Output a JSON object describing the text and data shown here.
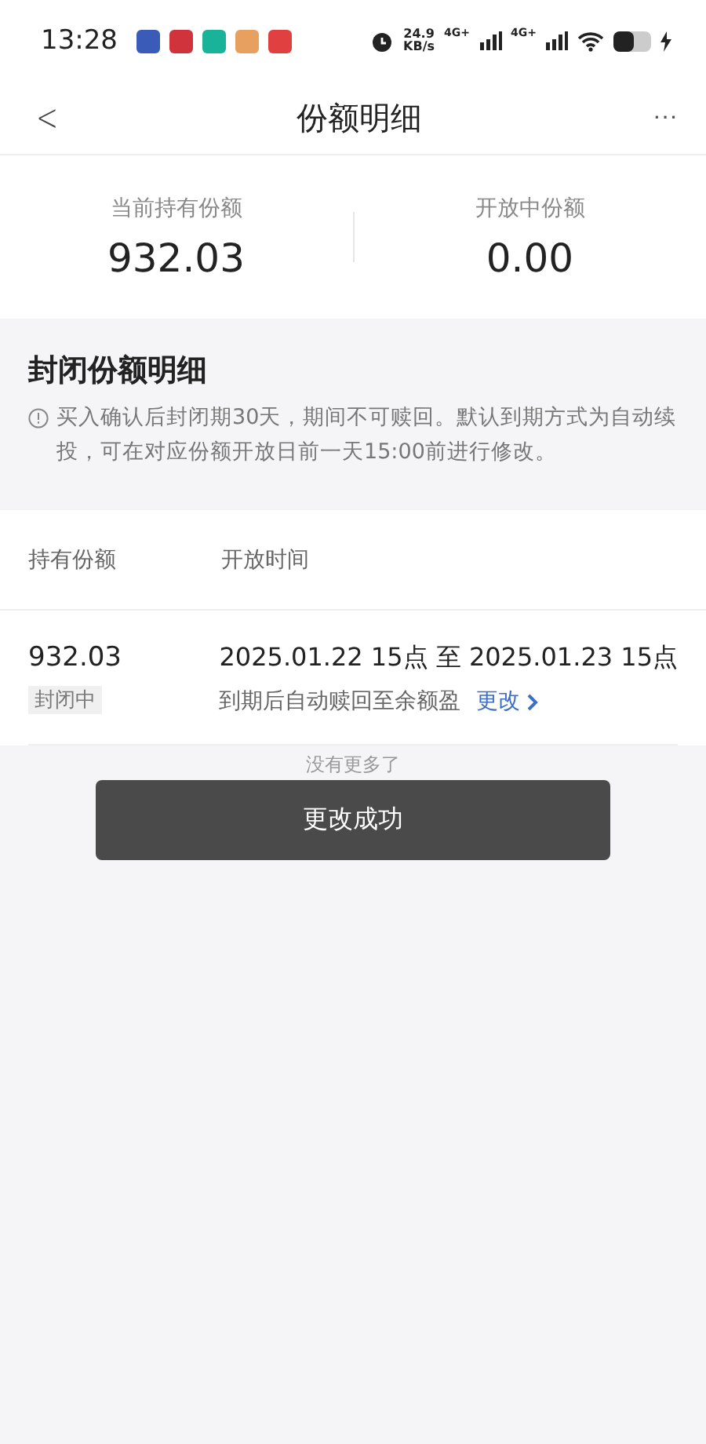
{
  "status_bar": {
    "time": "13:28",
    "network_speed": "24.9",
    "network_unit": "KB/s",
    "sim_labels": [
      "4G+",
      "4G+"
    ]
  },
  "header": {
    "title": "份额明细",
    "back": "<",
    "more": "···"
  },
  "summary": [
    {
      "label": "当前持有份额",
      "value": "932.03"
    },
    {
      "label": "开放中份额",
      "value": "0.00"
    }
  ],
  "closed_section": {
    "title": "封闭份额明细",
    "notice": "买入确认后封闭期30天，期间不可赎回。默认到期方式为自动续投，可在对应份额开放日前一天15:00前进行修改。"
  },
  "table": {
    "columns": [
      "持有份额",
      "开放时间"
    ],
    "rows": [
      {
        "amount": "932.03",
        "status": "封闭中",
        "period": "2025.01.22 15点 至 2025.01.23 15点",
        "maturity_action": "到期后自动赎回至余额盈",
        "change_link": "更改"
      }
    ]
  },
  "end_text": "没有更多了",
  "toast": {
    "message": "更改成功"
  }
}
